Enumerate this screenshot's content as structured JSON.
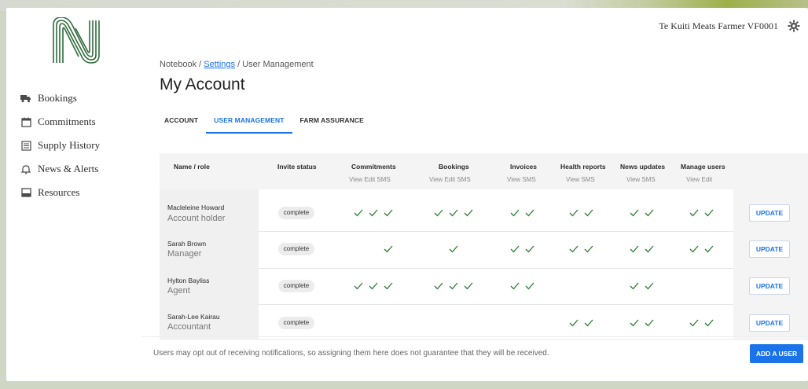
{
  "header": {
    "user_label": "Te Kuiti Meats Farmer VF0001"
  },
  "sidebar": {
    "items": [
      {
        "label": "Bookings",
        "icon": "truck-icon"
      },
      {
        "label": "Commitments",
        "icon": "calendar-icon"
      },
      {
        "label": "Supply History",
        "icon": "list-icon"
      },
      {
        "label": "News & Alerts",
        "icon": "bell-icon"
      },
      {
        "label": "Resources",
        "icon": "folder-icon"
      }
    ]
  },
  "breadcrumb": {
    "root": "Notebook",
    "sep1": "/",
    "link": "Settings",
    "sep2": "/",
    "current": "User Management"
  },
  "page": {
    "title": "My Account"
  },
  "tabs": [
    {
      "label": "ACCOUNT"
    },
    {
      "label": "USER MANAGEMENT"
    },
    {
      "label": "FARM ASSURANCE"
    }
  ],
  "table": {
    "headers": {
      "name_role": "Name / role",
      "invite": "Invite status",
      "commitments": "Commitments",
      "bookings": "Bookings",
      "invoices": "Invoices",
      "health": "Health reports",
      "news": "News updates",
      "manage": "Manage users"
    },
    "subheaders": {
      "commitments": "View  Edit  SMS",
      "bookings": "View  Edit  SMS",
      "invoices": "View  SMS",
      "health": "View  SMS",
      "news": "View  SMS",
      "manage": "View  Edit"
    },
    "rows": [
      {
        "name": "Macleleine Howard",
        "role": "Account holder",
        "status": "complete",
        "update": "UPDATE"
      },
      {
        "name": "Sarah Brown",
        "role": "Manager",
        "status": "complete",
        "update": "UPDATE"
      },
      {
        "name": "Hylton Bayliss",
        "role": "Agent",
        "status": "complete",
        "update": "UPDATE"
      },
      {
        "name": "Sarah-Lee Kairau",
        "role": "Accountant",
        "status": "complete",
        "update": "UPDATE"
      }
    ]
  },
  "footer": {
    "note": "Users may opt out of receiving notifications, so assigning them here does not guarantee that they will be received.",
    "add_user": "ADD A USER"
  },
  "colors": {
    "accent": "#1a73e8",
    "check": "#2e7d32"
  }
}
